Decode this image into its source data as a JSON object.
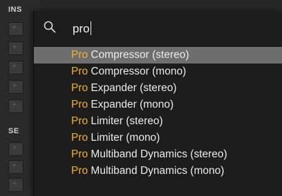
{
  "sidebar": {
    "section_top_label": "INS",
    "section_bottom_label": "SE"
  },
  "search": {
    "value": "pro",
    "placeholder": ""
  },
  "results": [
    {
      "match": "Pro",
      "rest": " Compressor (stereo)",
      "selected": true
    },
    {
      "match": "Pro",
      "rest": " Compressor (mono)",
      "selected": false
    },
    {
      "match": "Pro",
      "rest": " Expander (stereo)",
      "selected": false
    },
    {
      "match": "Pro",
      "rest": " Expander (mono)",
      "selected": false
    },
    {
      "match": "Pro",
      "rest": " Limiter (stereo)",
      "selected": false
    },
    {
      "match": "Pro",
      "rest": " Limiter (mono)",
      "selected": false
    },
    {
      "match": "Pro",
      "rest": " Multiband Dynamics (stereo)",
      "selected": false
    },
    {
      "match": "Pro",
      "rest": " Multiband Dynamics (mono)",
      "selected": false
    }
  ],
  "colors": {
    "match_highlight": "#f0b429",
    "selected_row": "#6e6e6e",
    "popup_bg": "#1c1c1c"
  }
}
